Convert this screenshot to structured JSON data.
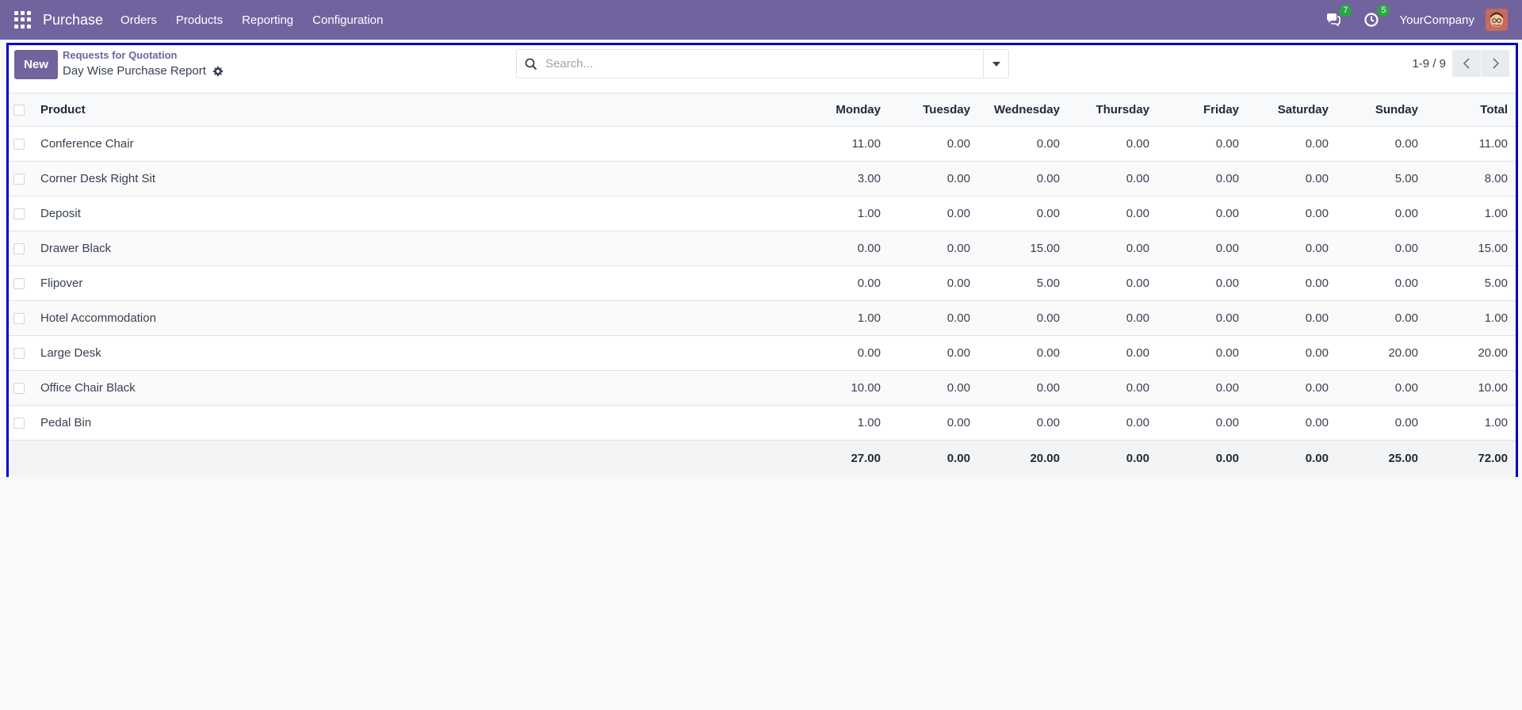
{
  "navbar": {
    "brand": "Purchase",
    "menu": [
      "Orders",
      "Products",
      "Reporting",
      "Configuration"
    ],
    "messages_count": "7",
    "activities_count": "5",
    "company": "YourCompany"
  },
  "control": {
    "new_label": "New",
    "breadcrumb": "Requests for Quotation",
    "title": "Day Wise Purchase Report",
    "search_placeholder": "Search...",
    "pager": "1-9 / 9"
  },
  "table": {
    "columns": [
      "Product",
      "Monday",
      "Tuesday",
      "Wednesday",
      "Thursday",
      "Friday",
      "Saturday",
      "Sunday",
      "Total"
    ],
    "rows": [
      [
        "Conference Chair",
        "11.00",
        "0.00",
        "0.00",
        "0.00",
        "0.00",
        "0.00",
        "0.00",
        "11.00"
      ],
      [
        "Corner Desk Right Sit",
        "3.00",
        "0.00",
        "0.00",
        "0.00",
        "0.00",
        "0.00",
        "5.00",
        "8.00"
      ],
      [
        "Deposit",
        "1.00",
        "0.00",
        "0.00",
        "0.00",
        "0.00",
        "0.00",
        "0.00",
        "1.00"
      ],
      [
        "Drawer Black",
        "0.00",
        "0.00",
        "15.00",
        "0.00",
        "0.00",
        "0.00",
        "0.00",
        "15.00"
      ],
      [
        "Flipover",
        "0.00",
        "0.00",
        "5.00",
        "0.00",
        "0.00",
        "0.00",
        "0.00",
        "5.00"
      ],
      [
        "Hotel Accommodation",
        "1.00",
        "0.00",
        "0.00",
        "0.00",
        "0.00",
        "0.00",
        "0.00",
        "1.00"
      ],
      [
        "Large Desk",
        "0.00",
        "0.00",
        "0.00",
        "0.00",
        "0.00",
        "0.00",
        "20.00",
        "20.00"
      ],
      [
        "Office Chair Black",
        "10.00",
        "0.00",
        "0.00",
        "0.00",
        "0.00",
        "0.00",
        "0.00",
        "10.00"
      ],
      [
        "Pedal Bin",
        "1.00",
        "0.00",
        "0.00",
        "0.00",
        "0.00",
        "0.00",
        "0.00",
        "1.00"
      ]
    ],
    "totals": [
      "27.00",
      "0.00",
      "20.00",
      "0.00",
      "0.00",
      "0.00",
      "25.00",
      "72.00"
    ]
  },
  "colors": {
    "brand": "#71639e",
    "frame": "#0000c8",
    "badge": "#28a745"
  },
  "icons": [
    "apps-icon",
    "chat-icon",
    "clock-icon",
    "gear-icon",
    "search-icon",
    "caret-down-icon",
    "chevron-left-icon",
    "chevron-right-icon"
  ]
}
